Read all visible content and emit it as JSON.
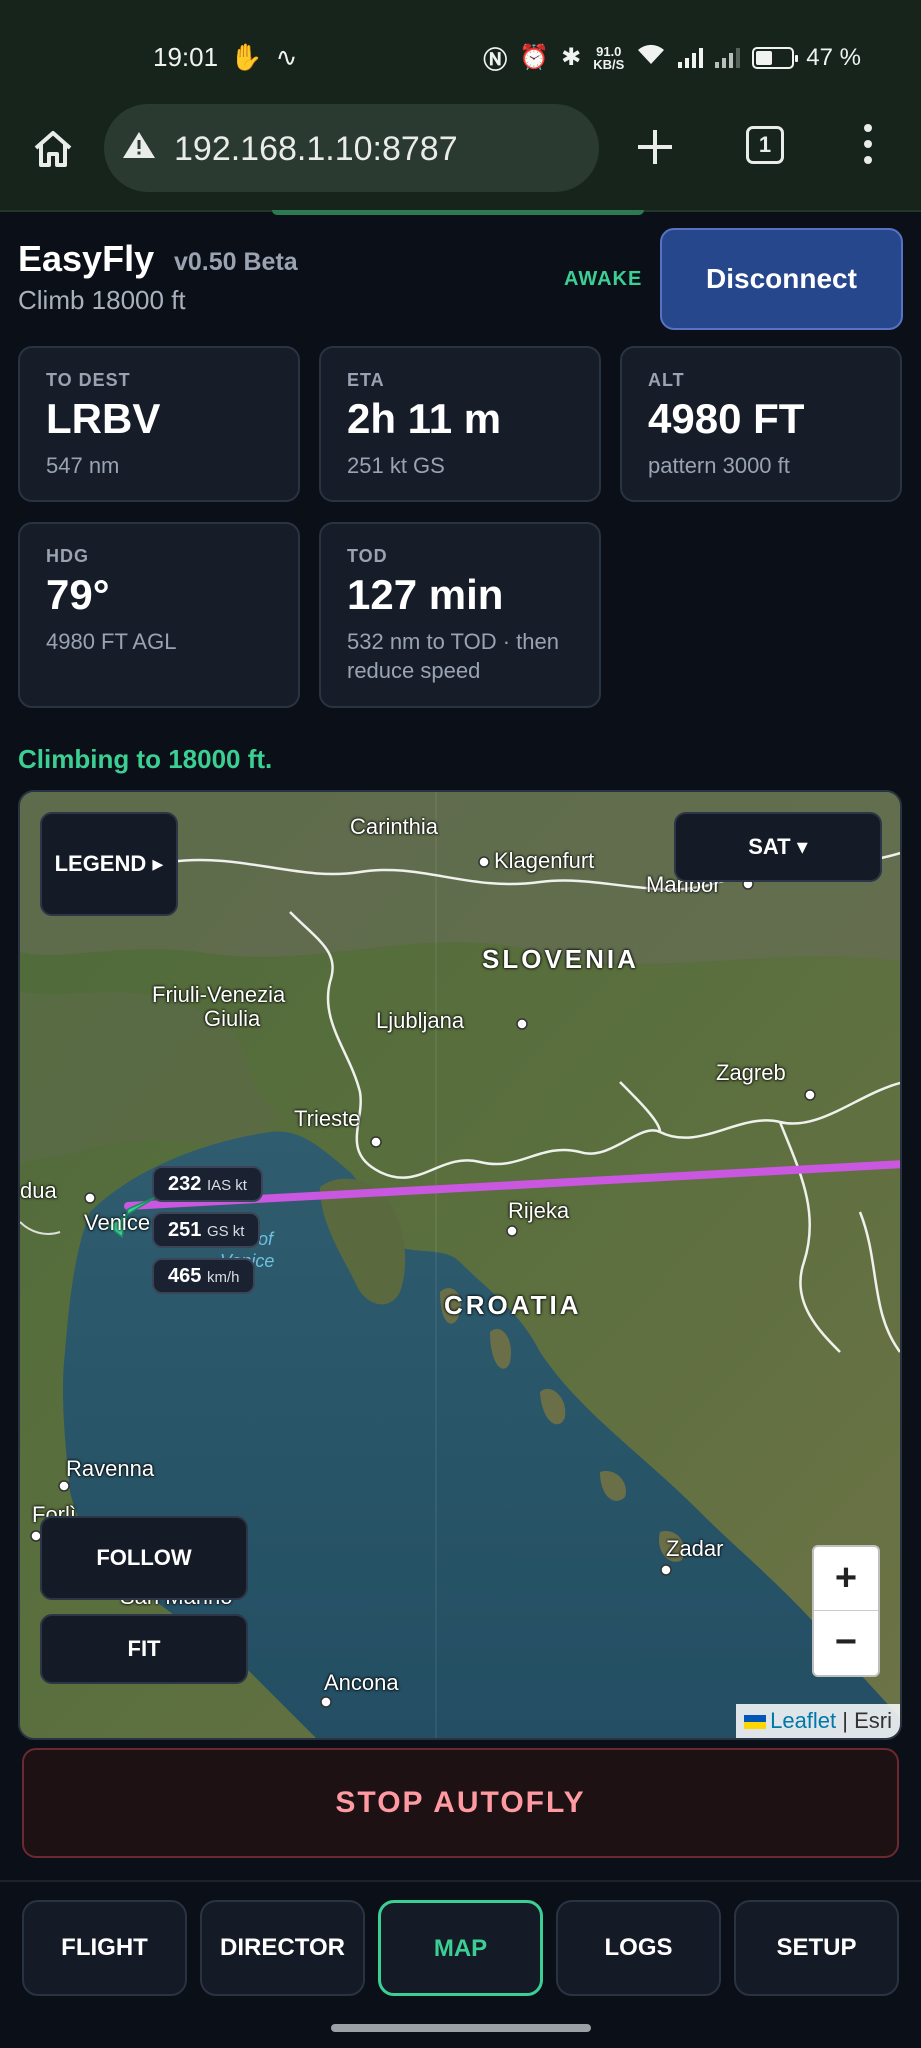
{
  "status_bar": {
    "time": "19:01",
    "net_speed_value": "91.0",
    "net_speed_unit": "KB/S",
    "battery_percent": "47 %",
    "battery_level": 0.47
  },
  "browser": {
    "url": "192.168.1.10:8787",
    "tab_count": "1"
  },
  "header": {
    "app_name": "EasyFly",
    "version": "v0.50 Beta",
    "subtitle": "Climb 18000 ft",
    "awake_label": "AWAKE",
    "disconnect_label": "Disconnect"
  },
  "cards": [
    {
      "label": "TO DEST",
      "value": "LRBV",
      "sub": "547 nm"
    },
    {
      "label": "ETA",
      "value": "2h 11 m",
      "sub": "251 kt GS"
    },
    {
      "label": "ALT",
      "value": "4980 FT",
      "sub": "pattern 3000 ft"
    },
    {
      "label": "HDG",
      "value": "79°",
      "sub": "4980 FT AGL"
    },
    {
      "label": "TOD",
      "value": "127 min",
      "sub": "532 nm to TOD · then reduce speed"
    }
  ],
  "status_message": "Climbing to 18000 ft.",
  "map": {
    "legend_label": "LEGEND ▸",
    "layer_label": "SAT ▾",
    "follow_label": "FOLLOW",
    "fit_label": "FIT",
    "zoom_in": "+",
    "zoom_out": "−",
    "attribution_leaflet": "Leaflet",
    "attribution_sep": " | ",
    "attribution_esri": "Esri",
    "places": {
      "carinthia": "Carinthia",
      "klagenfurt": "Klagenfurt",
      "maribor": "Maribor",
      "slovenia": "SLOVENIA",
      "friuli1": "Friuli-Venezia",
      "friuli2": "Giulia",
      "ljubljana": "Ljubljana",
      "zagreb": "Zagreb",
      "trieste": "Trieste",
      "padua": "dua",
      "venice": "Venice",
      "rijeka": "Rijeka",
      "gulf": "Gulf of Venice",
      "croatia": "CROATIA",
      "ravenna": "Ravenna",
      "forli": "Forlì",
      "sanmarino": "San Marino",
      "zadar": "Zadar",
      "ancona": "Ancona"
    },
    "speeds": [
      {
        "value": "232",
        "unit": "IAS kt"
      },
      {
        "value": "251",
        "unit": "GS kt"
      },
      {
        "value": "465",
        "unit": "km/h"
      }
    ]
  },
  "stop_label": "STOP AUTOFLY",
  "nav": [
    {
      "label": "FLIGHT",
      "active": false
    },
    {
      "label": "DIRECTOR",
      "active": false
    },
    {
      "label": "MAP",
      "active": true
    },
    {
      "label": "LOGS",
      "active": false
    },
    {
      "label": "SETUP",
      "active": false
    }
  ],
  "colors": {
    "accent_green": "#3ccf93",
    "route_magenta": "#c957e0",
    "disconnect_blue": "#27478d",
    "stop_text": "#ff9aa2"
  }
}
